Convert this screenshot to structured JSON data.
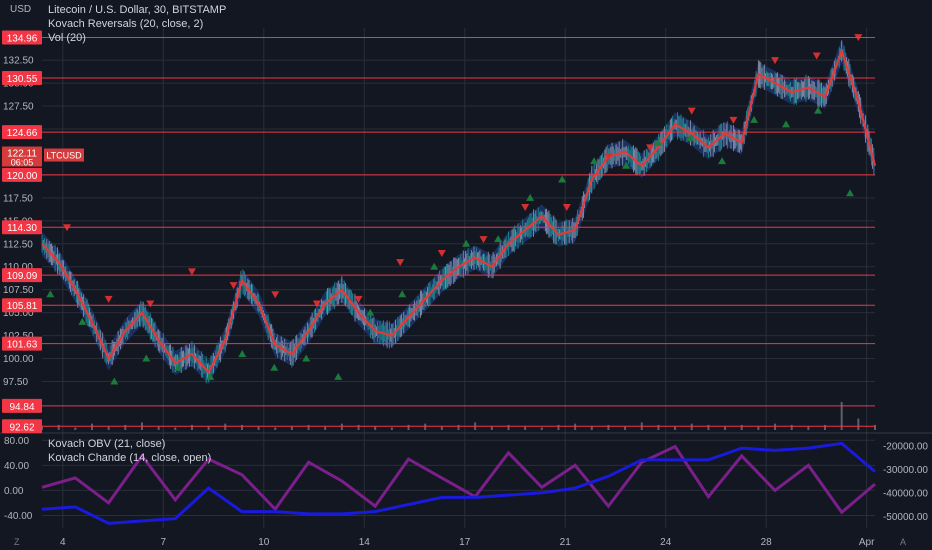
{
  "header": {
    "currency": "USD",
    "legend": [
      "Litecoin / U.S. Dollar, 30, BITSTAMP",
      "Kovach Reversals (20, close, 2)",
      "Vol (20)"
    ],
    "lower_legend": [
      "Kovach OBV (21, close)",
      "Kovach Chande (14, close, open)"
    ],
    "corner_left": "Z",
    "corner_right": "A"
  },
  "colors": {
    "background": "#131722",
    "grid": "#2a2e39",
    "level_line": "#f23645",
    "level_label_bg": "#f23645",
    "price_line": "#e03a3a",
    "band": "#1e3a78",
    "up_marker": "#1b7a3c",
    "down_marker": "#d32f2f",
    "obv": "#1a1adc",
    "chande": "#7b1f8a",
    "text": "#d1d4dc",
    "axis_text": "#b2b5be"
  },
  "current_price": {
    "value": "122.11",
    "time": "06:05",
    "symbol": "LTCUSD"
  },
  "chart_data": [
    {
      "type": "line",
      "title": "Litecoin / U.S. Dollar, 30, BITSTAMP",
      "x_tick_labels": [
        "4",
        "7",
        "10",
        "14",
        "17",
        "21",
        "24",
        "28",
        "Apr"
      ],
      "y_tick_labels": [
        "132.50",
        "130.00",
        "127.50",
        "125.00",
        "120.00",
        "117.50",
        "115.00",
        "112.50",
        "110.00",
        "107.50",
        "105.00",
        "102.50",
        "100.00",
        "97.50"
      ],
      "ylim": [
        92.0,
        136.0
      ],
      "levels": [
        "134.96",
        "130.55",
        "124.66",
        "120.00",
        "114.30",
        "109.09",
        "105.81",
        "101.63",
        "94.84",
        "92.62"
      ],
      "series": [
        {
          "name": "",
          "x": [
            0,
            0.02,
            0.04,
            0.06,
            0.08,
            0.1,
            0.12,
            0.14,
            0.16,
            0.18,
            0.2,
            0.22,
            0.24,
            0.26,
            0.28,
            0.3,
            0.32,
            0.34,
            0.36,
            0.38,
            0.4,
            0.42,
            0.44,
            0.46,
            0.48,
            0.5,
            0.52,
            0.54,
            0.56,
            0.58,
            0.6,
            0.62,
            0.64,
            0.66,
            0.68,
            0.7,
            0.72,
            0.74,
            0.76,
            0.78,
            0.8,
            0.82,
            0.84,
            0.86,
            0.88,
            0.9,
            0.92,
            0.94,
            0.96,
            0.98,
            1.0
          ],
          "values": [
            112.5,
            110.5,
            107.5,
            104.0,
            100.0,
            103.0,
            105.0,
            102.0,
            99.5,
            100.5,
            98.5,
            102.0,
            108.5,
            106.0,
            101.5,
            100.5,
            103.0,
            106.0,
            107.5,
            105.0,
            103.0,
            102.5,
            104.5,
            106.5,
            108.5,
            110.0,
            111.0,
            110.0,
            112.5,
            114.0,
            115.5,
            113.5,
            114.0,
            119.5,
            122.0,
            122.5,
            121.0,
            123.0,
            125.5,
            124.5,
            123.0,
            124.5,
            123.5,
            131.0,
            130.0,
            129.0,
            129.5,
            128.5,
            133.5,
            128.0,
            121.0
          ]
        }
      ],
      "up_markers": [
        107.0,
        104.0,
        97.5,
        100.0,
        99.0,
        98.0,
        100.5,
        99.0,
        100.0,
        98.0,
        105.0,
        107.0,
        110.0,
        112.5,
        113.0,
        117.5,
        119.5,
        121.5,
        121.0,
        123.5,
        124.0,
        121.5,
        126.0,
        125.5,
        127.0,
        118.0
      ],
      "down_markers": [
        114.3,
        106.5,
        106.0,
        109.5,
        108.0,
        107.0,
        106.0,
        106.5,
        110.5,
        111.5,
        113.0,
        116.5,
        116.5,
        122.0,
        123.0,
        127.0,
        126.0,
        132.5,
        133.0,
        135.0
      ]
    },
    {
      "type": "bar",
      "title": "Vol (20)",
      "values": [
        3,
        4,
        2,
        5,
        3,
        4,
        6,
        3,
        2,
        4,
        3,
        5,
        4,
        3,
        2,
        3,
        4,
        3,
        5,
        4,
        3,
        2,
        4,
        5,
        3,
        4,
        6,
        3,
        4,
        3,
        2,
        4,
        5,
        3,
        4,
        3,
        6,
        4,
        3,
        5,
        4,
        3,
        4,
        3,
        5,
        4,
        3,
        4,
        22,
        9,
        4
      ]
    },
    {
      "type": "line",
      "title": "Kovach OBV (21, close) / Kovach Chande (14, close, open)",
      "y_tick_labels_left": [
        "80.00",
        "40.00",
        "0.00",
        "-40.00"
      ],
      "y_tick_labels_right": [
        "-20000.00",
        "-30000.00",
        "-40000.00",
        "-50000.00"
      ],
      "ylim_left": [
        -60,
        90
      ],
      "ylim_right": [
        -55000,
        -15000
      ],
      "series": [
        {
          "name": "",
          "x": [
            0,
            0.04,
            0.08,
            0.12,
            0.16,
            0.2,
            0.24,
            0.28,
            0.32,
            0.36,
            0.4,
            0.44,
            0.48,
            0.52,
            0.56,
            0.6,
            0.64,
            0.68,
            0.72,
            0.76,
            0.8,
            0.84,
            0.88,
            0.92,
            0.96,
            1.0
          ],
          "values": [
            -47000,
            -46000,
            -53000,
            -52000,
            -51000,
            -38000,
            -48000,
            -48000,
            -49000,
            -49000,
            -48000,
            -45000,
            -42000,
            -42000,
            -41000,
            -40000,
            -38000,
            -33000,
            -26000,
            -26000,
            -26000,
            -21000,
            -22000,
            -21000,
            -19000,
            -31000
          ]
        },
        {
          "name": "",
          "x": [
            0,
            0.04,
            0.08,
            0.12,
            0.16,
            0.2,
            0.24,
            0.28,
            0.32,
            0.36,
            0.4,
            0.44,
            0.48,
            0.52,
            0.56,
            0.6,
            0.64,
            0.68,
            0.72,
            0.76,
            0.8,
            0.84,
            0.88,
            0.92,
            0.96,
            1.0
          ],
          "values": [
            5,
            20,
            -20,
            55,
            -15,
            50,
            25,
            -30,
            45,
            15,
            -25,
            50,
            20,
            -10,
            60,
            5,
            40,
            -25,
            45,
            70,
            -10,
            55,
            0,
            40,
            -35,
            10
          ]
        }
      ]
    }
  ]
}
